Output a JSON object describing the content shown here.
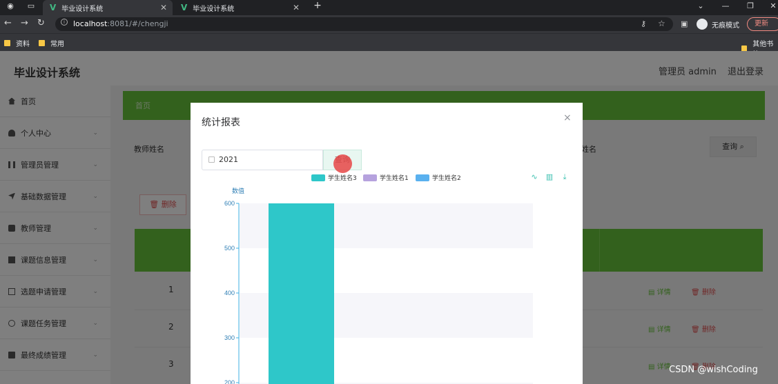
{
  "browser": {
    "tabs": [
      {
        "title": "毕业设计系统",
        "active": true
      },
      {
        "title": "毕业设计系统",
        "active": false
      }
    ],
    "new_tab": "+",
    "url_host": "localhost",
    "url_rest": ":8081/#/chengji",
    "incognito_label": "无痕模式",
    "update_label": "更新",
    "bookmarks": [
      "资料",
      "常用",
      "其他书签"
    ],
    "window_buttons": [
      "⌄",
      "—",
      "❐",
      "✕"
    ]
  },
  "app": {
    "title": "毕业设计系统",
    "admin_label": "管理员 admin",
    "logout_label": "退出登录"
  },
  "sidebar": {
    "items": [
      {
        "label": "首页",
        "icon": "home-icon"
      },
      {
        "label": "个人中心",
        "icon": "user-icon"
      },
      {
        "label": "管理员管理",
        "icon": "bar-icon"
      },
      {
        "label": "基础数据管理",
        "icon": "send-icon"
      },
      {
        "label": "教师管理",
        "icon": "teacher-icon"
      },
      {
        "label": "课题信息管理",
        "icon": "list-icon"
      },
      {
        "label": "选题申请管理",
        "icon": "doc-icon"
      },
      {
        "label": "课题任务管理",
        "icon": "task-icon"
      },
      {
        "label": "最终成绩管理",
        "icon": "grade-icon"
      }
    ]
  },
  "main": {
    "breadcrumb_home": "首页",
    "filter_teacher": "教师姓名",
    "filter_student": "姓名",
    "search_label": "查询",
    "delete_label": "删除",
    "rows": [
      {
        "num": "1",
        "detail": "详情",
        "remove": "删除"
      },
      {
        "num": "2",
        "detail": "详情",
        "remove": "删除"
      },
      {
        "num": "3",
        "detail": "详情",
        "remove": "删除"
      }
    ]
  },
  "dialog": {
    "title": "统计报表",
    "close": "×",
    "year_value": "2021",
    "query_label": "查询",
    "toolbox": [
      "line-chart-icon",
      "bar-chart-icon",
      "download-icon"
    ]
  },
  "chart_data": {
    "type": "bar",
    "ylabel": "数值",
    "yticks": [
      200,
      300,
      400,
      500,
      600
    ],
    "ylim": [
      200,
      600
    ],
    "legend_placement": "top",
    "series": [
      {
        "name": "学生姓名3",
        "color": "#2ec7c9",
        "values": [
          600
        ]
      },
      {
        "name": "学生姓名1",
        "color": "#b6a2de",
        "values": []
      },
      {
        "name": "学生姓名2",
        "color": "#5ab1ef",
        "values": []
      }
    ]
  },
  "watermark": "CSDN @wishCoding"
}
